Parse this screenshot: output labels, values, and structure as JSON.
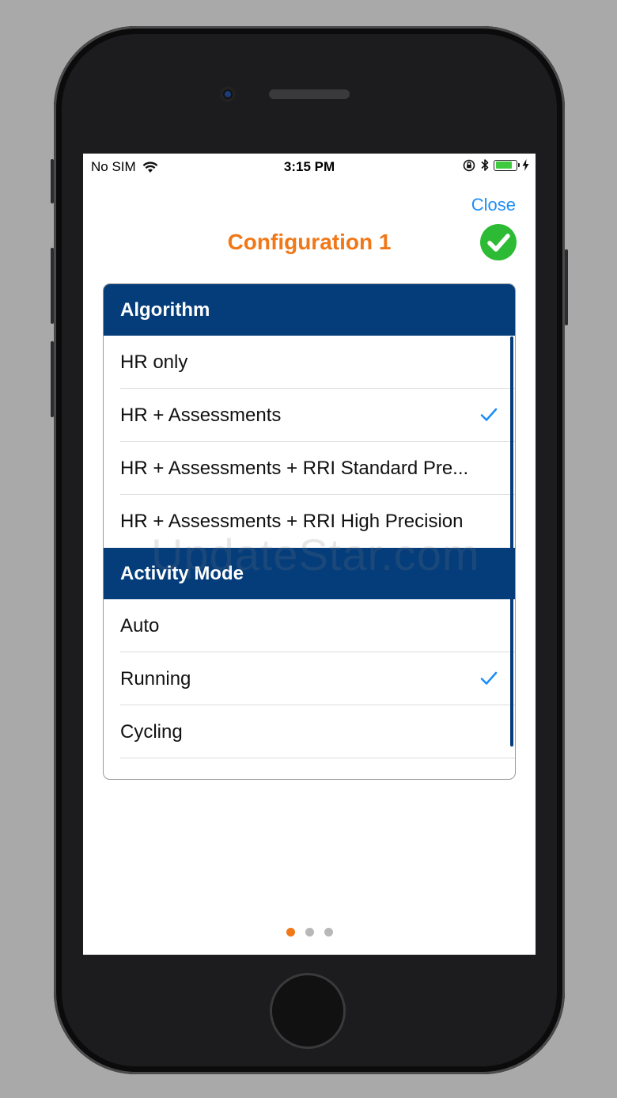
{
  "statusbar": {
    "carrier": "No SIM",
    "time": "3:15 PM",
    "battery_level": 0.85,
    "icons": [
      "wifi-icon",
      "orientation-lock-icon",
      "bluetooth-icon",
      "battery-icon",
      "charging-icon"
    ]
  },
  "header": {
    "close_label": "Close",
    "title": "Configuration 1",
    "status_icon": "checkmark-circle-icon"
  },
  "sections": [
    {
      "title": "Algorithm",
      "options": [
        {
          "label": "HR only",
          "selected": false
        },
        {
          "label": "HR + Assessments",
          "selected": true
        },
        {
          "label": "HR + Assessments + RRI Standard Pre...",
          "selected": false
        },
        {
          "label": "HR + Assessments + RRI High Precision",
          "selected": false
        }
      ]
    },
    {
      "title": "Activity Mode",
      "options": [
        {
          "label": "Auto",
          "selected": false
        },
        {
          "label": "Running",
          "selected": true
        },
        {
          "label": "Cycling",
          "selected": false
        }
      ]
    }
  ],
  "pager": {
    "pages": 3,
    "current": 1
  },
  "watermark": "UpdateStar.com",
  "colors": {
    "accent_orange": "#f07818",
    "header_blue": "#053d7a",
    "link_blue": "#1e8ef7",
    "success_green": "#2dbb35"
  }
}
